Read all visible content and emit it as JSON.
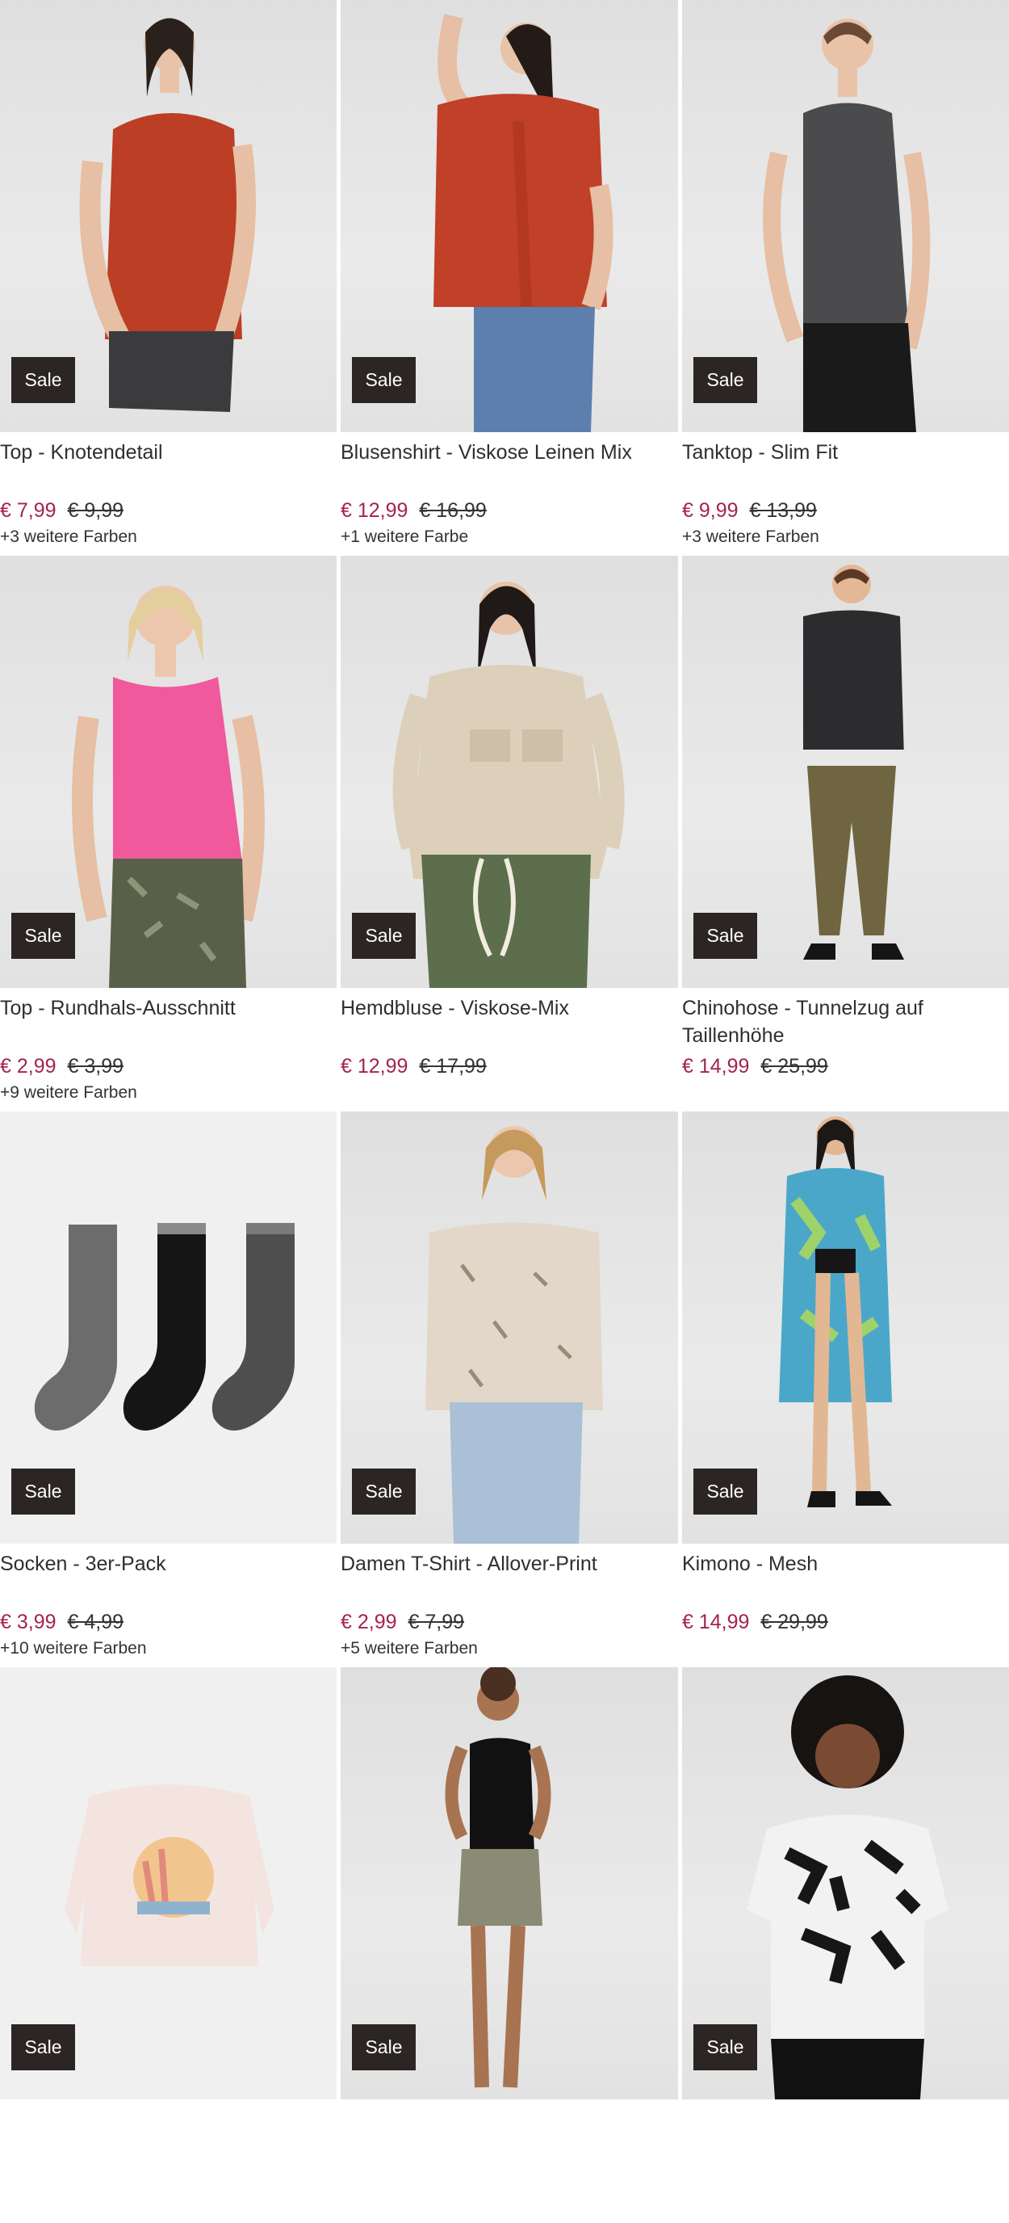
{
  "products": [
    {
      "title": "Top - Knotendetail",
      "price": "€ 7,99",
      "old_price": "€ 9,99",
      "colors": "+3 weitere Farben",
      "badge": "Sale"
    },
    {
      "title": "Blusenshirt - Viskose Leinen Mix",
      "price": "€ 12,99",
      "old_price": "€ 16,99",
      "colors": "+1 weitere Farbe",
      "badge": "Sale"
    },
    {
      "title": "Tanktop - Slim Fit",
      "price": "€ 9,99",
      "old_price": "€ 13,99",
      "colors": "+3 weitere Farben",
      "badge": "Sale"
    },
    {
      "title": "Top - Rundhals-Ausschnitt",
      "price": "€ 2,99",
      "old_price": "€ 3,99",
      "colors": "+9 weitere Farben",
      "badge": "Sale"
    },
    {
      "title": "Hemdbluse - Viskose-Mix",
      "price": "€ 12,99",
      "old_price": "€ 17,99",
      "colors": "",
      "badge": "Sale"
    },
    {
      "title": "Chinohose - Tunnelzug auf Taillenhöhe",
      "price": "€ 14,99",
      "old_price": "€ 25,99",
      "colors": "",
      "badge": "Sale"
    },
    {
      "title": "Socken - 3er-Pack",
      "price": "€ 3,99",
      "old_price": "€ 4,99",
      "colors": "+10 weitere Farben",
      "badge": "Sale"
    },
    {
      "title": "Damen T-Shirt - Allover-Print",
      "price": "€ 2,99",
      "old_price": "€ 7,99",
      "colors": "+5 weitere Farben",
      "badge": "Sale"
    },
    {
      "title": "Kimono - Mesh",
      "price": "€ 14,99",
      "old_price": "€ 29,99",
      "colors": "",
      "badge": "Sale"
    },
    {
      "title": "",
      "price": "",
      "old_price": "",
      "colors": "",
      "badge": "Sale"
    },
    {
      "title": "",
      "price": "",
      "old_price": "",
      "colors": "",
      "badge": "Sale"
    },
    {
      "title": "",
      "price": "",
      "old_price": "",
      "colors": "",
      "badge": "Sale"
    }
  ],
  "colors": {
    "sale_price": "#a4234f",
    "badge_bg": "#2b2523",
    "image_bg": "#e4e4e4"
  }
}
